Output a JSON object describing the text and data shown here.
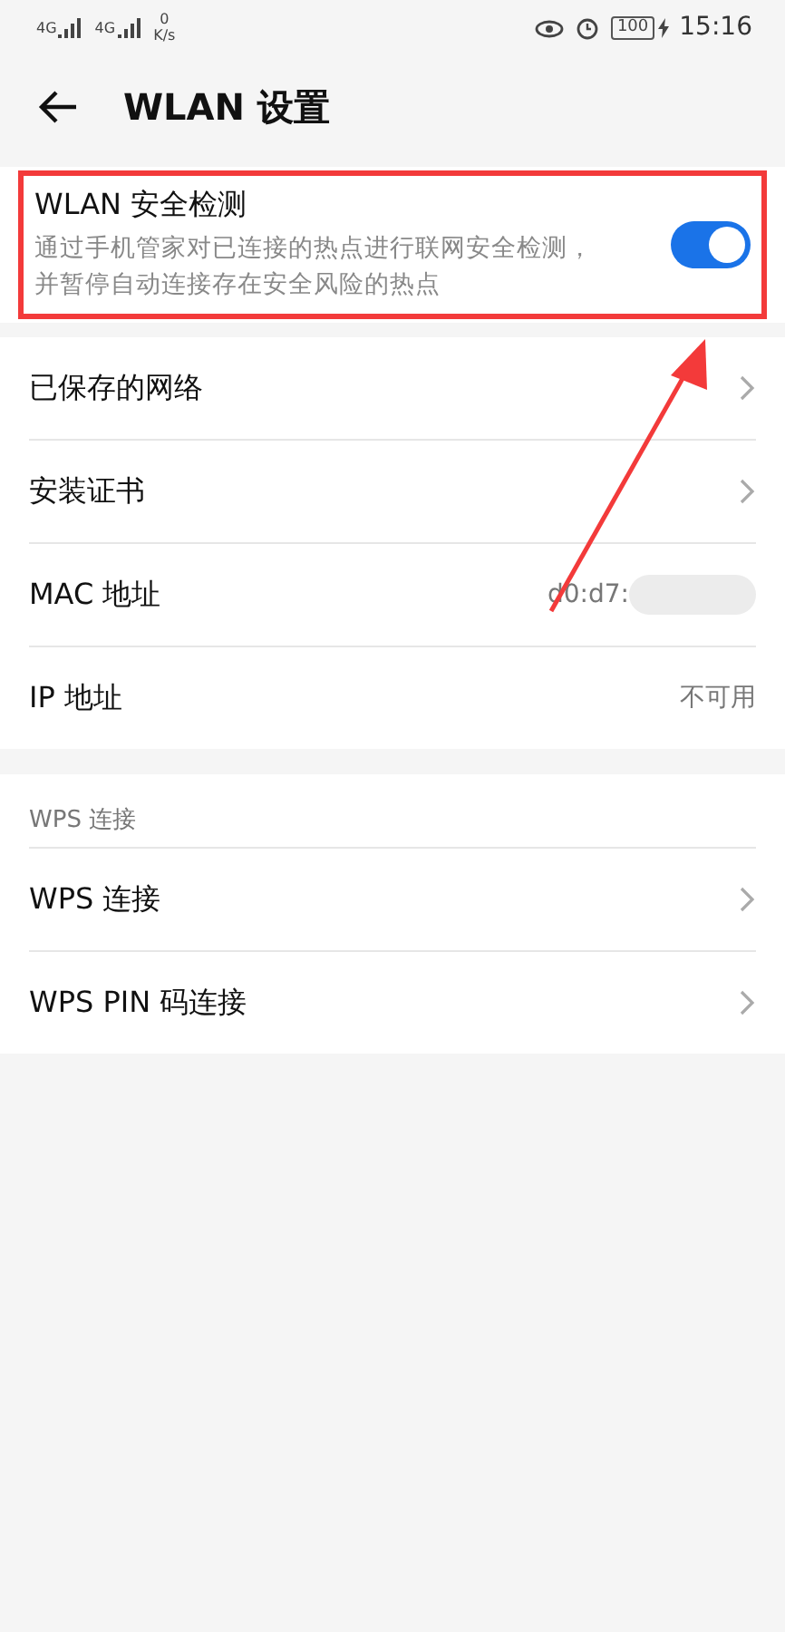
{
  "status_bar": {
    "signals": [
      "4G",
      "4G"
    ],
    "speed_value": "0",
    "speed_unit": "K/s",
    "battery": "100",
    "time": "15:16"
  },
  "header": {
    "title": "WLAN 设置"
  },
  "security": {
    "title": "WLAN 安全检测",
    "description": "通过手机管家对已连接的热点进行联网安全检测，并暂停自动连接存在安全风险的热点",
    "on": true,
    "highlighted": true
  },
  "network_rows": [
    {
      "kind": "link",
      "label": "已保存的网络"
    },
    {
      "kind": "link",
      "label": "安装证书"
    },
    {
      "kind": "hidden_value",
      "label": "MAC 地址",
      "value": "d0:d7:"
    },
    {
      "kind": "value",
      "label": "IP 地址",
      "value": "不可用"
    }
  ],
  "wps": {
    "heading": "WPS 连接",
    "rows": [
      {
        "kind": "link",
        "label": "WPS 连接"
      },
      {
        "kind": "link",
        "label": "WPS PIN 码连接"
      }
    ]
  }
}
